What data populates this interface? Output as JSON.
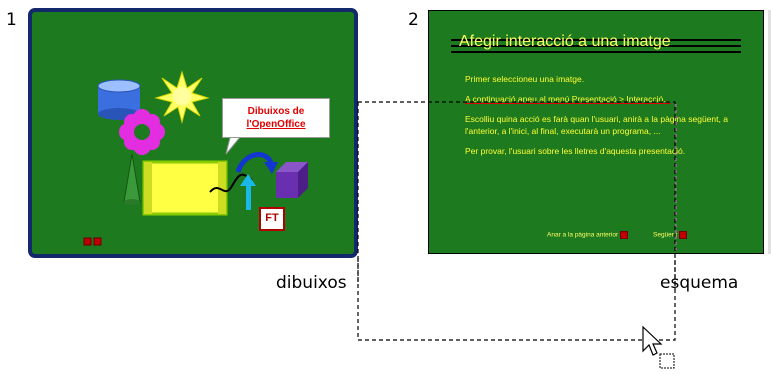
{
  "slides": [
    {
      "number": "1",
      "label": "dibuixos",
      "callout_lines": [
        "Dibuixos de",
        "l'OpenOffice"
      ],
      "ft_badge": "FT",
      "colors": {
        "background": "#1e7a1e",
        "border": "#14296b"
      }
    },
    {
      "number": "2",
      "label": "esquema",
      "title": "Afegir interacció a una imatge",
      "paragraphs": [
        "Primer seleccioneu una imatge.",
        "A continuació aneu al menú Presentació > Interacció...",
        "Escolliu quina acció es farà quan l'usuari, anirà a la pàgina següent, a l'anterior, a l'inici, al final, executarà un programa, ...",
        "Per provar, l'usuari sobre les lletres d'aquesta presentació."
      ],
      "footer_left": "Anar a la pàgina anterior",
      "footer_right": "Següent",
      "colors": {
        "background": "#1e7a1e",
        "text": "#ffff33"
      }
    }
  ],
  "icons": [
    "mouse-pointer-icon",
    "drag-copy-icon"
  ]
}
